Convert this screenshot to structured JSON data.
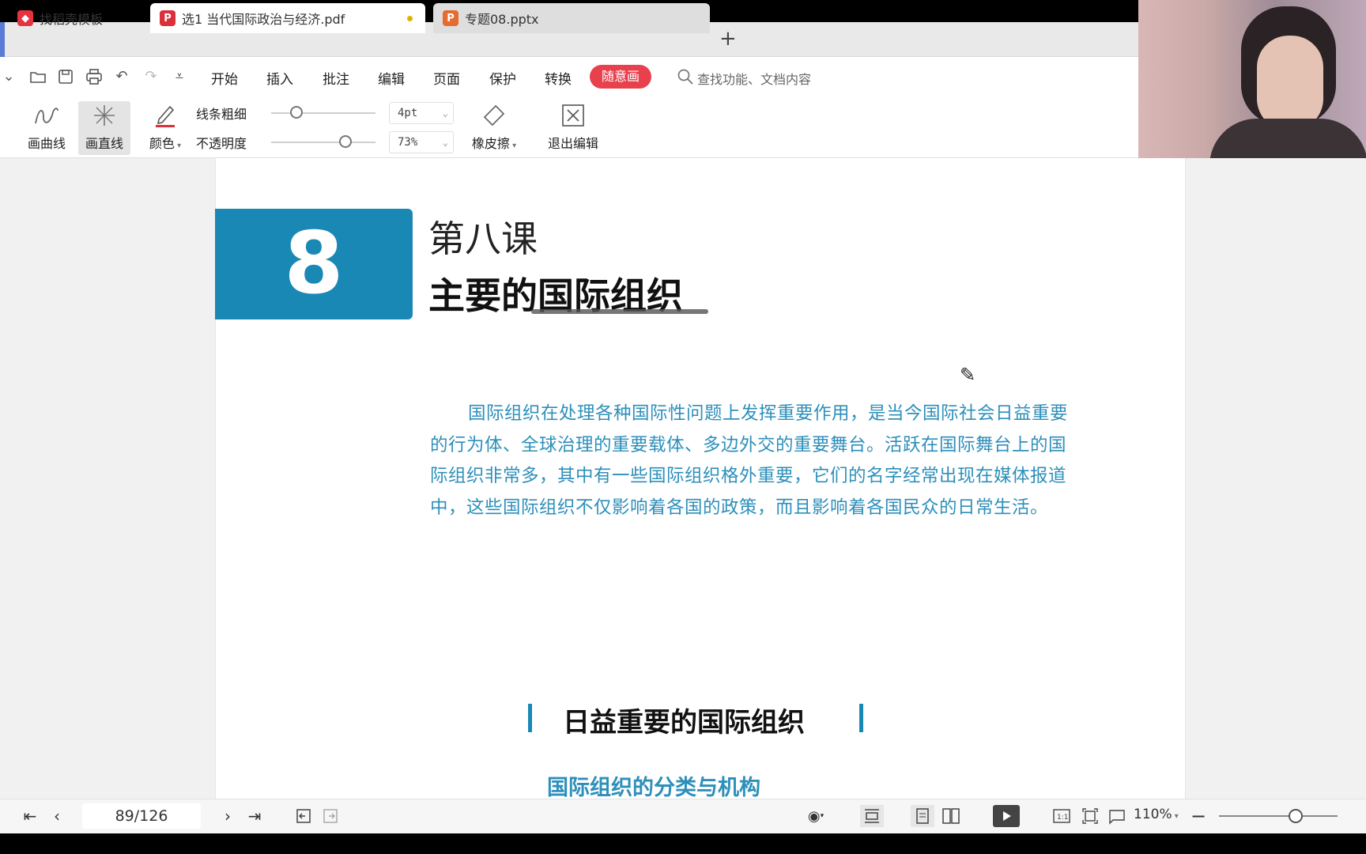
{
  "tabs": [
    {
      "label": "找稻壳模板",
      "icon": "docer-icon"
    },
    {
      "label": "选1 当代国际政治与经济.pdf",
      "icon": "pdf-icon",
      "unsaved": true
    },
    {
      "label": "专题08.pptx",
      "icon": "pptx-icon"
    }
  ],
  "menu": {
    "items": [
      "开始",
      "插入",
      "批注",
      "编辑",
      "页面",
      "保护",
      "转换"
    ],
    "free_draw": "随意画",
    "search_placeholder": "查找功能、文档内容"
  },
  "toolbar": {
    "draw_curve": "画曲线",
    "draw_line": "画直线",
    "color": "颜色",
    "line_width_label": "线条粗细",
    "line_width_value": "4pt",
    "opacity_label": "不透明度",
    "opacity_value": "73%",
    "eraser": "橡皮擦",
    "exit_edit": "退出编辑",
    "pen_color": "#d9303b"
  },
  "document": {
    "chapter_number": "8",
    "lesson_number": "第八课",
    "lesson_title": "主要的国际组织",
    "intro": "国际组织在处理各种国际性问题上发挥重要作用，是当今国际社会日益重要的行为体、全球治理的重要载体、多边外交的重要舞台。活跃在国际舞台上的国际组织非常多，其中有一些国际组织格外重要，它们的名字经常出现在媒体报道中，这些国际组织不仅影响着各国的政策，而且影响着各国民众的日常生活。",
    "section_title": "日益重要的国际组织",
    "subsection_title": "国际组织的分类与机构",
    "accent_color": "#1a88b5"
  },
  "status": {
    "page_indicator": "89/126",
    "zoom": "110%"
  }
}
